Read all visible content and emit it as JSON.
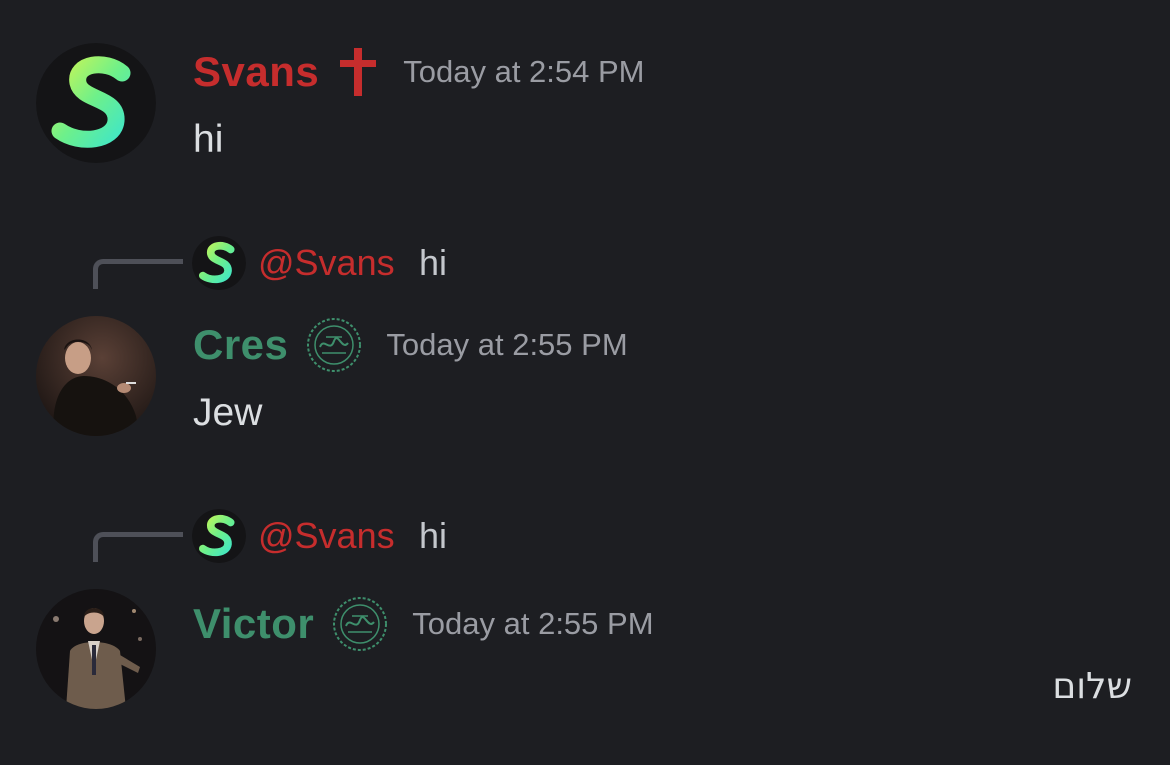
{
  "colors": {
    "background": "#1d1e22",
    "svans_name": "#c62d2d",
    "cres_name": "#3e8f6c",
    "victor_name": "#3e8f6c",
    "timestamp": "#9a9ca3",
    "reply_spine": "#4e5058"
  },
  "messages": [
    {
      "author": "Svans",
      "role_icon": "cross-icon",
      "timestamp": "Today at 2:54 PM",
      "text": "hi"
    },
    {
      "reply": {
        "mention": "@Svans",
        "text": "hi"
      },
      "author": "Cres",
      "role_icon": "green-emblem-icon",
      "timestamp": "Today at 2:55 PM",
      "text": "Jew"
    },
    {
      "reply": {
        "mention": "@Svans",
        "text": "hi"
      },
      "author": "Victor",
      "role_icon": "green-emblem-icon",
      "timestamp": "Today at 2:55 PM",
      "text": "שלום"
    }
  ]
}
